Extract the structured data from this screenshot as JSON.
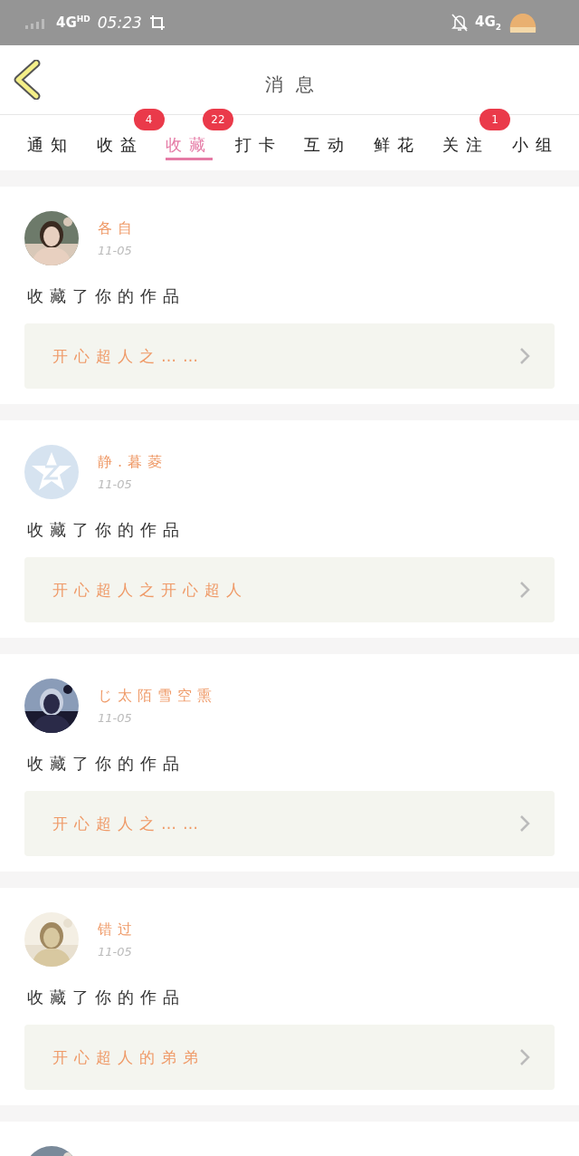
{
  "status_bar": {
    "network": "4G$^{HD}$",
    "time": "05:23",
    "network_2": "4G$_{2}$"
  },
  "header": {
    "title": "消息"
  },
  "tabs": [
    {
      "label": "通知",
      "selected": false
    },
    {
      "label": "收益",
      "selected": false,
      "badge": "4"
    },
    {
      "label": "收藏",
      "selected": true,
      "badge": "22"
    },
    {
      "label": "打卡",
      "selected": false
    },
    {
      "label": "互动",
      "selected": false
    },
    {
      "label": "鲜花",
      "selected": false
    },
    {
      "label": "关注",
      "selected": false,
      "badge": "1"
    },
    {
      "label": "小组",
      "selected": false
    }
  ],
  "messages": [
    {
      "avatar": {
        "kind": "picture"
      },
      "name": "各自",
      "date": "11-05",
      "text": "收藏了你的作品",
      "work": "开心超人之……"
    },
    {
      "avatar": {
        "kind": "default"
      },
      "name": "静.暮菱",
      "date": "11-05",
      "text": "收藏了你的作品",
      "work": "开心超人之开心超人"
    },
    {
      "avatar": {
        "kind": "picture"
      },
      "name": "じ太陌雪空熏",
      "date": "11-05",
      "text": "收藏了你的作品",
      "work": "开心超人之……"
    },
    {
      "avatar": {
        "kind": "picture"
      },
      "name": "错过",
      "date": "11-05",
      "text": "收藏了你的作品",
      "work": "开心超人的弟弟"
    },
    {
      "avatar": {
        "kind": "picture"
      }
    }
  ]
}
